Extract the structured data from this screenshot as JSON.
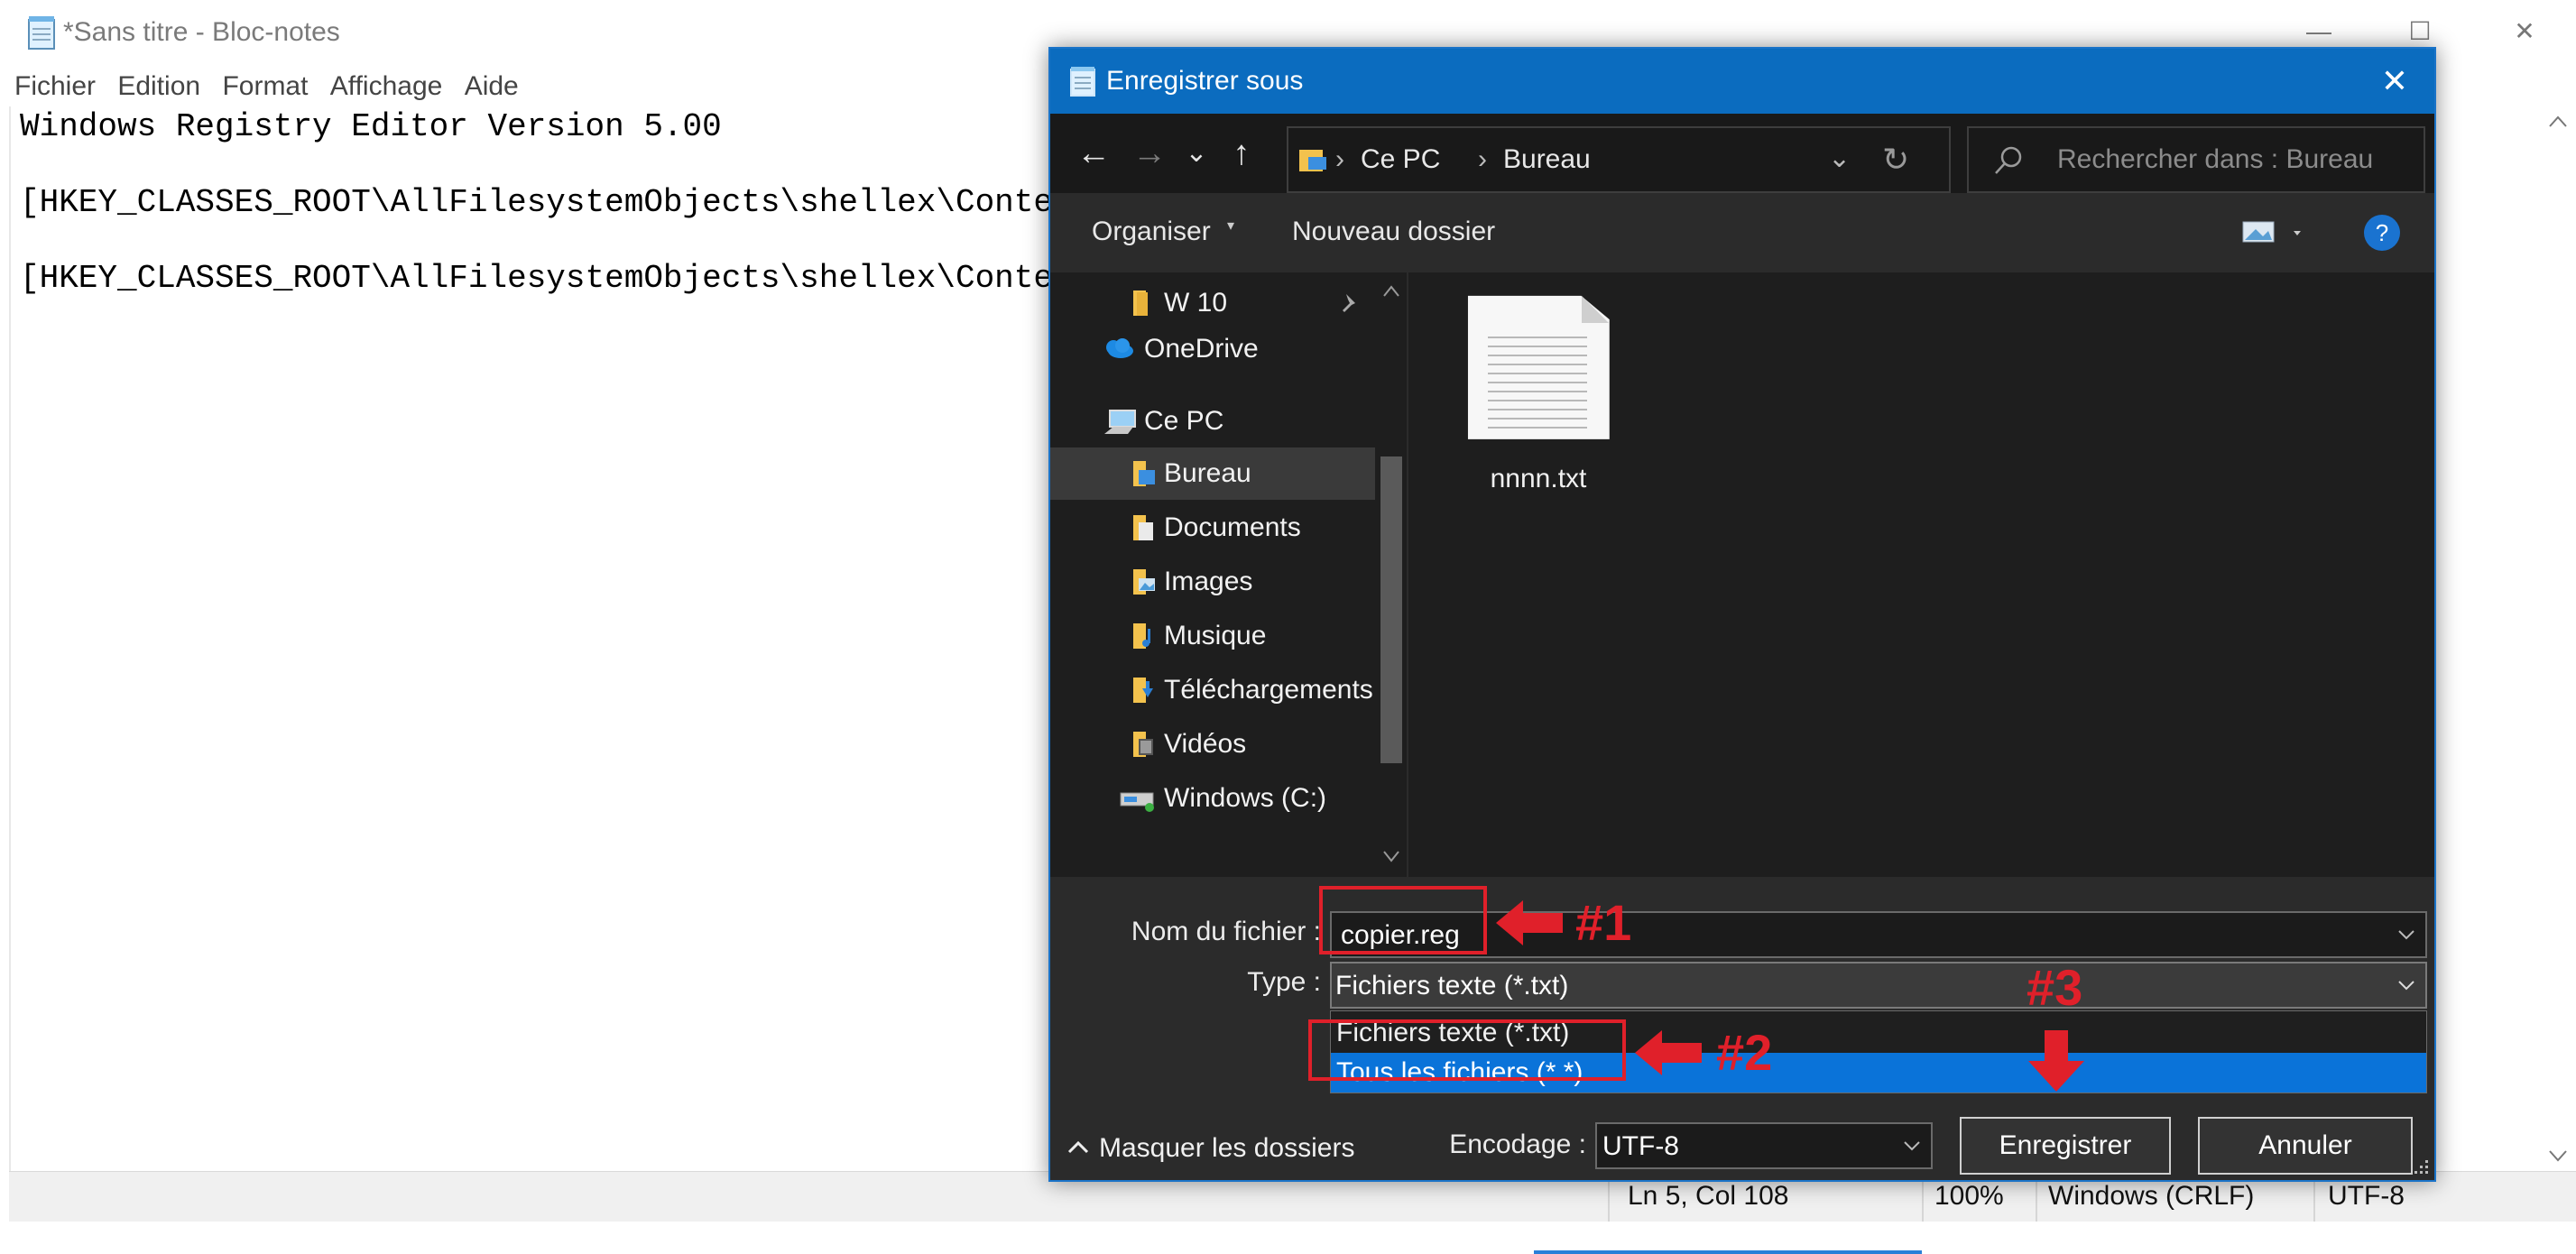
{
  "notepad": {
    "title": "*Sans titre - Bloc-notes",
    "menu": [
      "Fichier",
      "Edition",
      "Format",
      "Affichage",
      "Aide"
    ],
    "lines": [
      "Windows Registry Editor Version 5.00",
      "[HKEY_CLASSES_ROOT\\AllFilesystemObjects\\shellex\\ContextMe",
      "[HKEY_CLASSES_ROOT\\AllFilesystemObjects\\shellex\\ContextMe"
    ],
    "status": {
      "position": "Ln 5, Col 108",
      "zoom": "100%",
      "line_ending": "Windows (CRLF)",
      "encoding": "UTF-8"
    },
    "window_buttons": {
      "minimize": "—",
      "maximize": "☐",
      "close": "✕"
    }
  },
  "dialog": {
    "title": "Enregistrer sous",
    "close": "✕",
    "nav": {
      "back": "←",
      "forward": "→",
      "recent": "⌄",
      "up": "↑",
      "refresh": "↻",
      "dropdown": "⌄"
    },
    "breadcrumb": [
      "Ce PC",
      "Bureau"
    ],
    "breadcrumb_sep": "›",
    "search_placeholder": "Rechercher dans : Bureau",
    "toolbar": {
      "organize": "Organiser",
      "new_folder": "Nouveau dossier",
      "help": "?"
    },
    "nav_items": [
      {
        "label": "W 10",
        "icon": "folder-icon"
      },
      {
        "label": "OneDrive",
        "icon": "cloud-icon"
      },
      {
        "label": "Ce PC",
        "icon": "computer-icon"
      },
      {
        "label": "Bureau",
        "icon": "desktop-folder-icon",
        "selected": true
      },
      {
        "label": "Documents",
        "icon": "documents-folder-icon"
      },
      {
        "label": "Images",
        "icon": "pictures-folder-icon"
      },
      {
        "label": "Musique",
        "icon": "music-folder-icon"
      },
      {
        "label": "Téléchargements",
        "icon": "downloads-folder-icon"
      },
      {
        "label": "Vidéos",
        "icon": "videos-folder-icon"
      },
      {
        "label": "Windows (C:)",
        "icon": "drive-icon"
      }
    ],
    "files": [
      {
        "name": "nnnn.txt",
        "icon": "text-file-icon"
      }
    ],
    "filename_label": "Nom du fichier :",
    "filename_value": "copier.reg",
    "type_label": "Type :",
    "type_value": "Fichiers texte (*.txt)",
    "type_options": [
      "Fichiers texte (*.txt)",
      "Tous les fichiers  (*.*)"
    ],
    "selected_type_index": 1,
    "hide_folders": "Masquer les dossiers",
    "encoding_label": "Encodage :",
    "encoding_value": "UTF-8",
    "save_button": "Enregistrer",
    "cancel_button": "Annuler"
  },
  "annotations": {
    "label1": "#1",
    "label2": "#2",
    "label3": "#3",
    "color": "#e0202a"
  }
}
